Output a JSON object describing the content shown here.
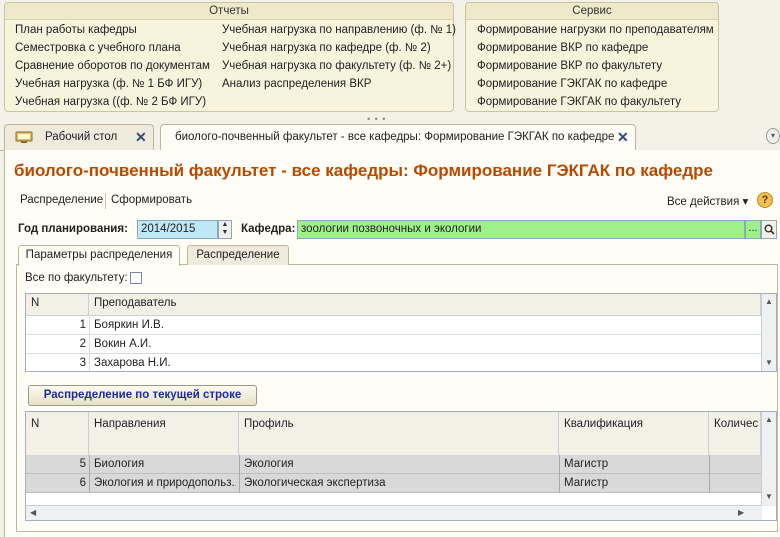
{
  "reports": {
    "title": "Отчеты",
    "col1": [
      "План работы кафедры",
      "Семестровка с учебного плана",
      "Сравнение оборотов по документам",
      "Учебная нагрузка (ф. № 1 БФ ИГУ)",
      "Учебная нагрузка ((ф. № 2 БФ ИГУ)"
    ],
    "col2": [
      "Учебная нагрузка по направлению (ф. № 1)",
      "Учебная нагрузка по кафедре (ф. № 2)",
      "Учебная нагрузка по факультету (ф. № 2+)",
      "Анализ распределения ВКР"
    ]
  },
  "service": {
    "title": "Сервис",
    "items": [
      "Формирование нагрузки по преподавателям",
      "Формирование ВКР по кафедре",
      "Формирование ВКР по факультету",
      "Формирование ГЭКГАК по кафедре",
      "Формирование ГЭКГАК по факультету"
    ]
  },
  "tabs": {
    "desktop": "Рабочий стол",
    "form": "биолого-почвенный факультет - все кафедры: Формирование ГЭКГАК по кафедре",
    "close_glyph": "✕"
  },
  "form": {
    "title": "биолого-почвенный факультет - все кафедры: Формирование ГЭКГАК по кафедре",
    "cmd_distribute": "Распределение",
    "cmd_generate": "Сформировать",
    "all_actions": "Все действия ▾",
    "help": "?",
    "year_label": "Год планирования:",
    "year_value": "2014/2015",
    "dept_label": "Кафедра:",
    "dept_value": "зоологии позвоночных и экологии",
    "dept_btn": "...",
    "subtab_params": "Параметры распределения",
    "subtab_distribution": "Распределение",
    "all_faculty_label": "Все по факультету:",
    "distribute_btn": "Распределение по текущей строке"
  },
  "teachers": {
    "headers": {
      "n": "N",
      "teacher": "Преподаватель"
    },
    "rows": [
      {
        "n": "1",
        "name": "Бояркин И.В."
      },
      {
        "n": "2",
        "name": "Вокин А.И."
      },
      {
        "n": "3",
        "name": "Захарова Н.И."
      }
    ]
  },
  "directions": {
    "headers": {
      "n": "N",
      "direction": "Направления",
      "profile": "Профиль",
      "qual": "Квалификация",
      "count": "Количес"
    },
    "rows": [
      {
        "n": "5",
        "direction": "Биология",
        "profile": "Экология",
        "qual": "Магистр"
      },
      {
        "n": "6",
        "direction": "Экология и природопольз...",
        "profile": "Экологическая экспертиза",
        "qual": "Магистр"
      }
    ]
  },
  "colors": {
    "title": "#b84a00",
    "year_bg": "#bfe8f5",
    "dept_bg": "#9ef08a",
    "button_text": "#1b2c9a"
  }
}
